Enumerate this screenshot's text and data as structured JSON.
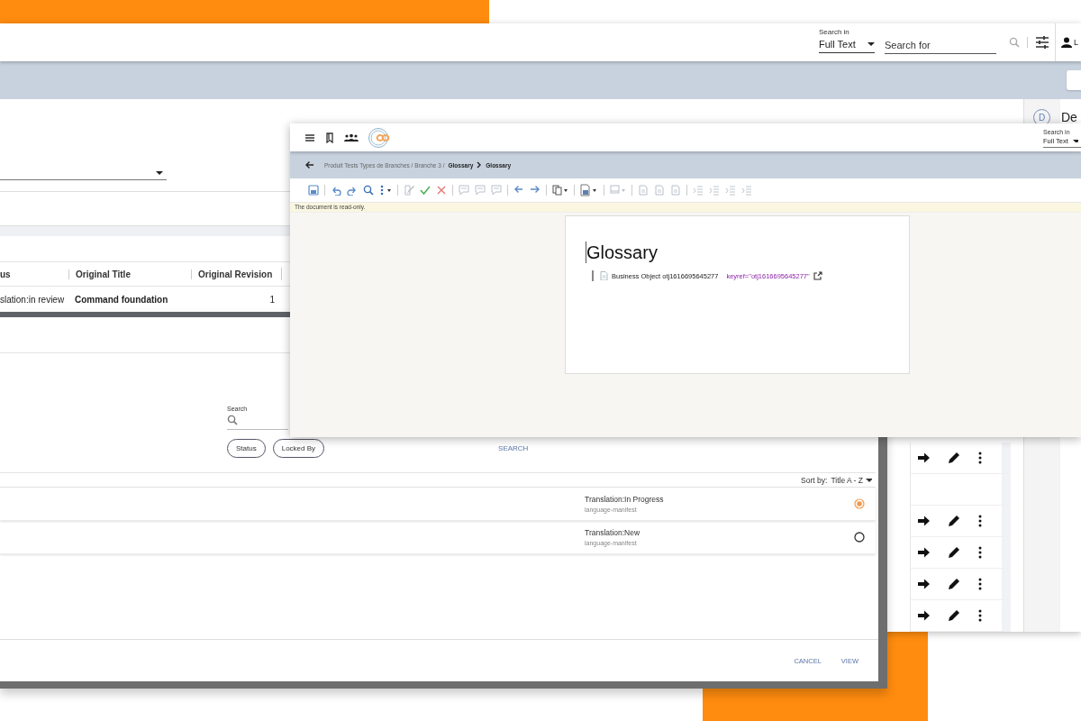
{
  "back_window": {
    "header": {
      "search_in_label": "Search in",
      "search_scope": "Full Text",
      "search_placeholder": "Search for",
      "user_name": "L"
    },
    "details_panel": {
      "avatar": "D",
      "title": "De"
    },
    "table": {
      "columns": [
        "us",
        "Original Title",
        "Original Revision"
      ],
      "rows": [
        {
          "cells": [
            "slation:in review",
            "Command foundation",
            "1"
          ]
        }
      ]
    },
    "action_rows": [
      {
        "kind": "actions"
      },
      {
        "kind": "empty"
      },
      {
        "kind": "actions"
      },
      {
        "kind": "actions"
      },
      {
        "kind": "actions"
      },
      {
        "kind": "actions"
      }
    ]
  },
  "dialog": {
    "search_label": "Search",
    "filters": [
      "Status",
      "Locked By"
    ],
    "search_button": "SEARCH",
    "sort_label": "Sort by:",
    "sort_value": "Title A - Z",
    "items": [
      {
        "title": "Translation:In Progress",
        "subtitle": "language-manifest",
        "selected": true
      },
      {
        "title": "Translation:New",
        "subtitle": "language-manifest",
        "selected": false
      }
    ],
    "buttons": [
      "CANCEL",
      "VIEW"
    ]
  },
  "editor": {
    "search_in_label": "Search in",
    "search_scope": "Full Text",
    "breadcrumb": {
      "path": "Produit Tests Types de Branches / Branche 3 /",
      "links": [
        "Glossary",
        "Glossary"
      ]
    },
    "toolbar": [
      {
        "items": [
          {
            "kind": "save",
            "disabled": false
          }
        ]
      },
      {
        "items": [
          {
            "kind": "undo",
            "disabled": false
          },
          {
            "kind": "redo",
            "disabled": false
          },
          {
            "kind": "find",
            "disabled": false
          },
          {
            "kind": "more",
            "disabled": false
          }
        ]
      },
      {
        "items": [
          {
            "kind": "track",
            "disabled": true
          },
          {
            "kind": "accept",
            "disabled": false
          },
          {
            "kind": "reject",
            "disabled": false
          }
        ]
      },
      {
        "items": [
          {
            "kind": "comment",
            "disabled": true
          },
          {
            "kind": "comment",
            "disabled": true
          },
          {
            "kind": "comment",
            "disabled": true
          }
        ]
      },
      {
        "items": [
          {
            "kind": "prev",
            "disabled": false
          },
          {
            "kind": "next",
            "disabled": false
          }
        ]
      },
      {
        "items": [
          {
            "kind": "copy",
            "disabled": false
          }
        ]
      },
      {
        "items": [
          {
            "kind": "map",
            "disabled": false
          }
        ]
      },
      {
        "items": [
          {
            "kind": "panel",
            "disabled": true
          }
        ]
      },
      {
        "items": [
          {
            "kind": "page",
            "disabled": true
          },
          {
            "kind": "page",
            "disabled": true
          },
          {
            "kind": "page",
            "disabled": true
          }
        ]
      },
      {
        "items": [
          {
            "kind": "indent",
            "disabled": true
          },
          {
            "kind": "indent",
            "disabled": true
          },
          {
            "kind": "indent",
            "disabled": true
          },
          {
            "kind": "indent",
            "disabled": true
          }
        ]
      }
    ],
    "notice": "The document is read-only.",
    "document": {
      "title": "Glossary",
      "entries": [
        {
          "text": "Business Object otj1616695645277",
          "keyref": "keyref=\"otj1616695645277\""
        }
      ]
    }
  }
}
